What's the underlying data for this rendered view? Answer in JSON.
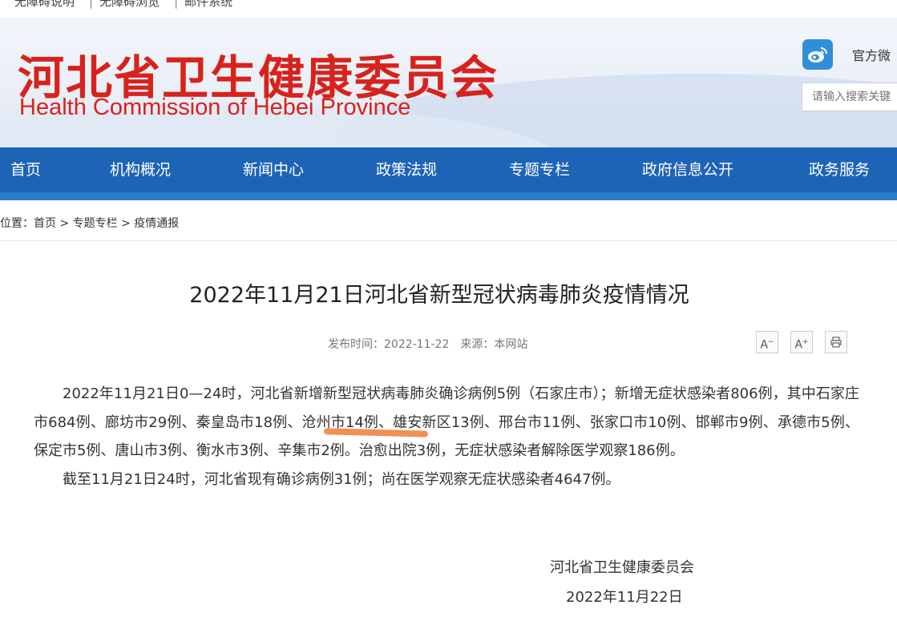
{
  "top_links": [
    "无障碍说明",
    "无障碍浏览",
    "邮件系统"
  ],
  "header": {
    "title_cn": "河北省卫生健康委员会",
    "title_en": "Health Commission of Hebei Province",
    "weibo_label": "官方微",
    "search_placeholder": "请输入搜索关键"
  },
  "nav": [
    "首页",
    "机构概况",
    "新闻中心",
    "政策法规",
    "专题专栏",
    "政府信息公开",
    "政务服务"
  ],
  "breadcrumb": {
    "prefix": "位置：",
    "items": [
      "首页",
      "专题专栏",
      "疫情通报"
    ],
    "sep": " > "
  },
  "article": {
    "title": "2022年11月21日河北省新型冠状病毒肺炎疫情情况",
    "publish_time": "发布时间：2022-11-22",
    "source": "来源：本网站",
    "tools": [
      "A-",
      "A+",
      "print"
    ],
    "paragraph1": "2022年11月21日0—24时，河北省新增新型冠状病毒肺炎确诊病例5例（石家庄市）；新增无症状感染者806例，其中石家庄市684例、廊坊市29例、秦皇岛市18例、沧州市14例、雄安新区13例、邢台市11例、张家口市10例、邯郸市9例、承德市5例、保定市5例、唐山市3例、衡水市3例、辛集市2例。治愈出院3例，无症状感染者解除医学观察186例。",
    "paragraph2": "截至11月21日24时，河北省现有确诊病例31例；尚在医学观察无症状感染者4647例。",
    "sign_org": "河北省卫生健康委员会",
    "sign_date": "2022年11月22日"
  },
  "colors": {
    "brand_red": "#d8221c",
    "nav_blue": "#1e64b6",
    "highlight_orange": "#f08a4b"
  },
  "icons": [
    "weibo-icon",
    "font-decrease-icon",
    "font-increase-icon",
    "print-icon"
  ]
}
